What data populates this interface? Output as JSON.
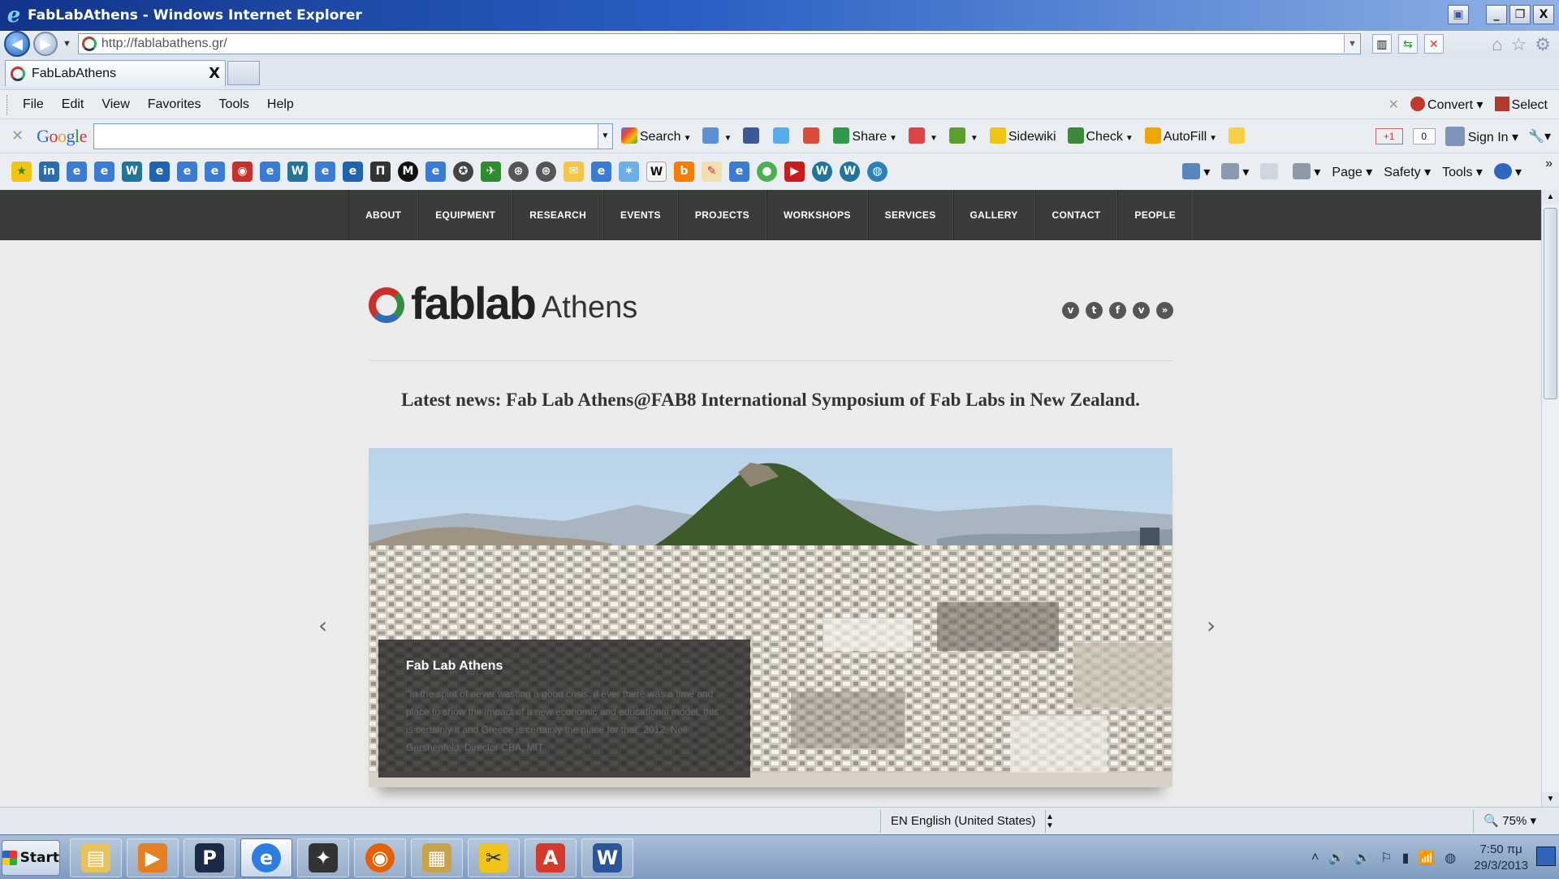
{
  "window": {
    "title": "FabLabAthens - Windows Internet Explorer",
    "controls": [
      "_",
      "❐",
      "X"
    ]
  },
  "address_bar": {
    "url": "http://fablabathens.gr/"
  },
  "tabs": [
    {
      "label": "FabLabAthens",
      "close": "X"
    }
  ],
  "menu": {
    "items": [
      "File",
      "Edit",
      "View",
      "Favorites",
      "Tools",
      "Help"
    ],
    "right": {
      "convert_label": "Convert",
      "select_label": "Select"
    }
  },
  "google_toolbar": {
    "logo": [
      "G",
      "o",
      "o",
      "g",
      "l",
      "e"
    ],
    "search_value": "",
    "items": [
      {
        "label": "Search",
        "icon": "google-search-icon"
      },
      {
        "label": "Share",
        "icon": "share-icon"
      },
      {
        "label": "Sidewiki",
        "icon": "sidewiki-icon"
      },
      {
        "label": "Check",
        "icon": "spellcheck-icon"
      },
      {
        "label": "AutoFill",
        "icon": "autofill-icon"
      }
    ],
    "plus_one": "+1",
    "plus_one_count": "0",
    "sign_in_label": "Sign In"
  },
  "command_bar": {
    "items": [
      {
        "label": "Page"
      },
      {
        "label": "Safety"
      },
      {
        "label": "Tools"
      }
    ]
  },
  "site": {
    "nav": [
      "ABOUT",
      "EQUIPMENT",
      "RESEARCH",
      "EVENTS",
      "PROJECTS",
      "WORKSHOPS",
      "SERVICES",
      "GALLERY",
      "CONTACT",
      "PEOPLE"
    ],
    "logo_text": "fablab",
    "logo_suffix": "Athens",
    "socials": [
      "vimeo",
      "tumblr",
      "facebook",
      "vine",
      "rss"
    ],
    "social_glyphs": [
      "v",
      "t",
      "f",
      "v",
      "»"
    ],
    "latest_news": "Latest news: Fab Lab Athens@FAB8 International Symposium of Fab Labs in New Zealand.",
    "slide": {
      "title": "Fab Lab Athens",
      "text": "\"In the spirit of never wasting a good crisis, if ever there was a time and place to show the impact of a new economic and educational model, this is certainly it and Greece is certainly the place for that\" 2012, Neil Gershenfeld, Director CBA, MIT"
    },
    "prev_arrow": "‹",
    "next_arrow": "›"
  },
  "status_bar": {
    "language": "EN English (United States)",
    "zoom": "75%"
  },
  "taskbar": {
    "start_label": "Start",
    "clock_time": "7:50 πμ",
    "clock_date": "29/3/2013"
  },
  "colors": {
    "site_nav_bg": "#3b3b3b",
    "page_bg": "#ececec",
    "caption_bg": "#1e1e1e",
    "accent_red": "#c8302a",
    "accent_green": "#2e8f3e",
    "accent_blue": "#2d6db5"
  }
}
